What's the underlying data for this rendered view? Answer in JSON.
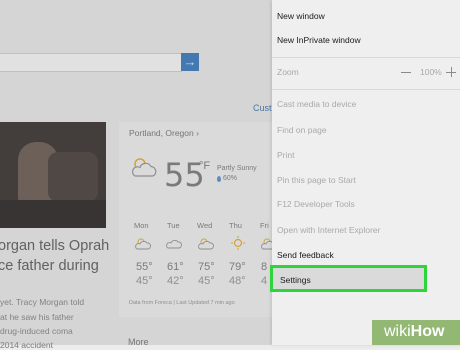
{
  "page": {
    "link_text": "Cust",
    "news": {
      "headline_line1": "organ tells Oprah",
      "headline_line2": "ce father during",
      "sub_line1": "yet. Tracy Morgan told",
      "sub_line2": "at he saw his father",
      "sub_line3": "drug-induced coma",
      "sub_line4": "2014 accident"
    },
    "weather": {
      "location": "Portland, Oregon",
      "temp": "55",
      "unit": "°F",
      "condition": "Partly Sunny",
      "humidity": "60%",
      "forecast": [
        {
          "day": "Mon",
          "hi": "55°",
          "lo": "45°",
          "icon": "partly-sunny-icon"
        },
        {
          "day": "Tue",
          "hi": "61°",
          "lo": "42°",
          "icon": "cloud-icon"
        },
        {
          "day": "Wed",
          "hi": "75°",
          "lo": "45°",
          "icon": "partly-sunny-icon"
        },
        {
          "day": "Thu",
          "hi": "79°",
          "lo": "48°",
          "icon": "sun-icon"
        },
        {
          "day": "Fri",
          "hi": "8",
          "lo": "4",
          "icon": "partly-sunny-icon"
        }
      ],
      "footer": "Data from Foreca | Last Updated 7 min ago"
    },
    "more_label": "More"
  },
  "menu": {
    "items": [
      {
        "label": "New window",
        "enabled": true
      },
      {
        "label": "New InPrivate window",
        "enabled": true
      },
      {
        "label": "Zoom",
        "enabled": false
      },
      {
        "label": "Cast media to device",
        "enabled": false
      },
      {
        "label": "Find on page",
        "enabled": false
      },
      {
        "label": "Print",
        "enabled": false
      },
      {
        "label": "Pin this page to Start",
        "enabled": false
      },
      {
        "label": "F12 Developer Tools",
        "enabled": false
      },
      {
        "label": "Open with Internet Explorer",
        "enabled": false
      },
      {
        "label": "Send feedback",
        "enabled": true
      },
      {
        "label": "Settings",
        "enabled": true
      }
    ],
    "zoom_value": "100%"
  },
  "colors": {
    "highlight_border": "#2dd43a",
    "watermark_bg": "#93b874",
    "search_button": "#2a6db6"
  },
  "watermark": {
    "prefix": "wiki",
    "suffix": "How"
  }
}
